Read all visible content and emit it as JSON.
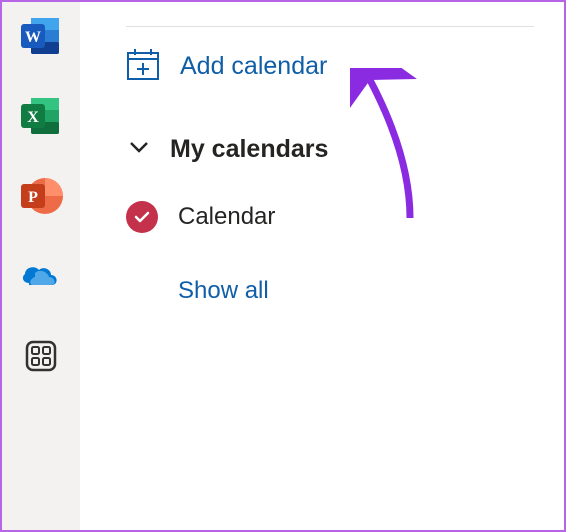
{
  "appRail": {
    "items": [
      {
        "name": "word-icon",
        "letter": "W",
        "bg": "#185abd",
        "accent": "#2b7cd3"
      },
      {
        "name": "excel-icon",
        "letter": "X",
        "bg": "#107c41",
        "accent": "#21a366"
      },
      {
        "name": "powerpoint-icon",
        "letter": "P",
        "bg": "#c43e1c",
        "accent": "#ed6c47"
      },
      {
        "name": "onedrive-icon",
        "letter": "",
        "bg": "#0078d4",
        "accent": "#50a8e8"
      },
      {
        "name": "apps-icon",
        "letter": "",
        "bg": "transparent",
        "accent": "#323130"
      }
    ]
  },
  "calendar_panel": {
    "add_label": "Add calendar",
    "section_label": "My calendars",
    "calendars": [
      {
        "name": "Calendar",
        "checked": true,
        "color": "#c4314b"
      }
    ],
    "show_all_label": "Show all"
  },
  "colors": {
    "link": "#0f5ea8",
    "text": "#252423"
  }
}
